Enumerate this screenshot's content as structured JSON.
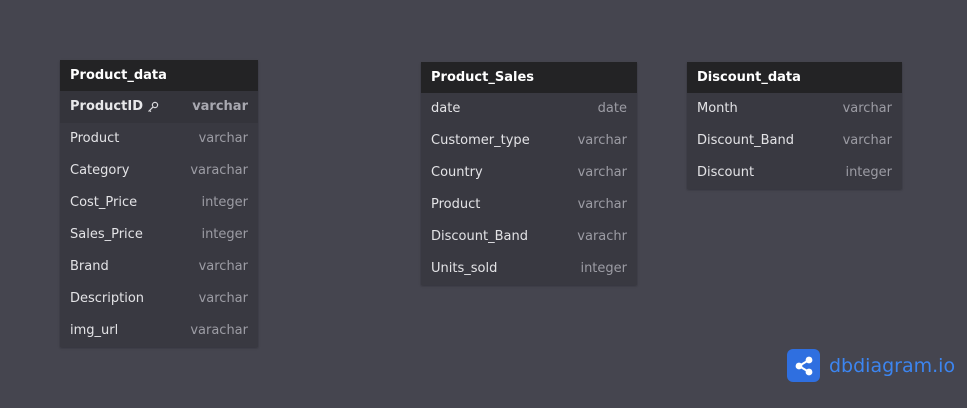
{
  "tables": [
    {
      "name": "Product_data",
      "fields": [
        {
          "name": "ProductID",
          "type": "varchar",
          "pk": true
        },
        {
          "name": "Product",
          "type": "varchar"
        },
        {
          "name": "Category",
          "type": "varachar"
        },
        {
          "name": "Cost_Price",
          "type": "integer"
        },
        {
          "name": "Sales_Price",
          "type": "integer"
        },
        {
          "name": "Brand",
          "type": "varchar"
        },
        {
          "name": "Description",
          "type": "varchar"
        },
        {
          "name": "img_url",
          "type": "varachar"
        }
      ]
    },
    {
      "name": "Product_Sales",
      "fields": [
        {
          "name": "date",
          "type": "date"
        },
        {
          "name": "Customer_type",
          "type": "varchar"
        },
        {
          "name": "Country",
          "type": "varchar"
        },
        {
          "name": "Product",
          "type": "varchar"
        },
        {
          "name": "Discount_Band",
          "type": "varachr"
        },
        {
          "name": "Units_sold",
          "type": "integer"
        }
      ]
    },
    {
      "name": "Discount_data",
      "fields": [
        {
          "name": "Month",
          "type": "varchar"
        },
        {
          "name": "Discount_Band",
          "type": "varchar"
        },
        {
          "name": "Discount",
          "type": "integer"
        }
      ]
    }
  ],
  "logo": {
    "text": "dbdiagram.io",
    "icon": "share-nodes-icon",
    "color": "#3c85f0",
    "bg_color": "#2f6fe0"
  },
  "key_icon": "key-icon"
}
